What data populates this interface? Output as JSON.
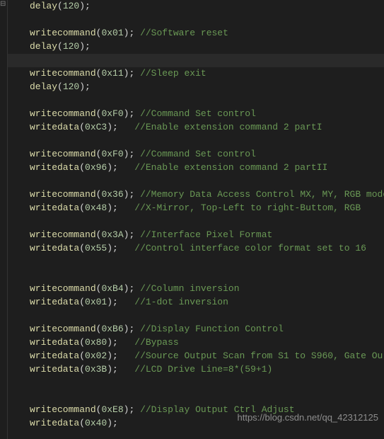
{
  "lines": [
    {
      "indent": true,
      "fn": "delay",
      "arg": "120",
      "comment": ""
    },
    {
      "blank": true
    },
    {
      "indent": true,
      "fn": "writecommand",
      "arg": "0x01",
      "comment": "//Software reset"
    },
    {
      "indent": true,
      "fn": "delay",
      "arg": "120",
      "comment": ""
    },
    {
      "indent": true,
      "active": true,
      "raw": ""
    },
    {
      "indent": true,
      "fn": "writecommand",
      "arg": "0x11",
      "comment": "//Sleep exit"
    },
    {
      "indent": true,
      "fn": "delay",
      "arg": "120",
      "comment": ""
    },
    {
      "blank": true
    },
    {
      "indent": true,
      "fn": "writecommand",
      "arg": "0xF0",
      "comment": "//Command Set control"
    },
    {
      "indent": true,
      "fn": "writedata",
      "arg": "0xC3",
      "pad": true,
      "comment": "//Enable extension command 2 partI"
    },
    {
      "blank": true
    },
    {
      "indent": true,
      "fn": "writecommand",
      "arg": "0xF0",
      "comment": "//Command Set control"
    },
    {
      "indent": true,
      "fn": "writedata",
      "arg": "0x96",
      "pad": true,
      "comment": "//Enable extension command 2 partII"
    },
    {
      "blank": true
    },
    {
      "indent": true,
      "fn": "writecommand",
      "arg": "0x36",
      "comment": "//Memory Data Access Control MX, MY, RGB mode"
    },
    {
      "indent": true,
      "fn": "writedata",
      "arg": "0x48",
      "pad": true,
      "comment": "//X-Mirror, Top-Left to right-Buttom, RGB"
    },
    {
      "blank": true
    },
    {
      "indent": true,
      "fn": "writecommand",
      "arg": "0x3A",
      "comment": "//Interface Pixel Format"
    },
    {
      "indent": true,
      "fn": "writedata",
      "arg": "0x55",
      "pad": true,
      "comment": "//Control interface color format set to 16"
    },
    {
      "blank": true
    },
    {
      "blank": true
    },
    {
      "indent": true,
      "fn": "writecommand",
      "arg": "0xB4",
      "comment": "//Column inversion"
    },
    {
      "indent": true,
      "fn": "writedata",
      "arg": "0x01",
      "pad": true,
      "comment": "//1-dot inversion"
    },
    {
      "blank": true
    },
    {
      "indent": true,
      "fn": "writecommand",
      "arg": "0xB6",
      "comment": "//Display Function Control"
    },
    {
      "indent": true,
      "fn": "writedata",
      "arg": "0x80",
      "pad": true,
      "comment": "//Bypass"
    },
    {
      "indent": true,
      "fn": "writedata",
      "arg": "0x02",
      "pad": true,
      "comment": "//Source Output Scan from S1 to S960, Gate Ou"
    },
    {
      "indent": true,
      "fn": "writedata",
      "arg": "0x3B",
      "pad": true,
      "comment": "//LCD Drive Line=8*(59+1)"
    },
    {
      "blank": true
    },
    {
      "blank": true
    },
    {
      "indent": true,
      "fn": "writecommand",
      "arg": "0xE8",
      "comment": "//Display Output Ctrl Adjust"
    },
    {
      "indent": true,
      "fn": "writedata",
      "arg": "0x40",
      "pad": true,
      "comment": ""
    }
  ],
  "watermark": "https://blog.csdn.net/qq_42312125",
  "collapse_glyph": "⊟"
}
